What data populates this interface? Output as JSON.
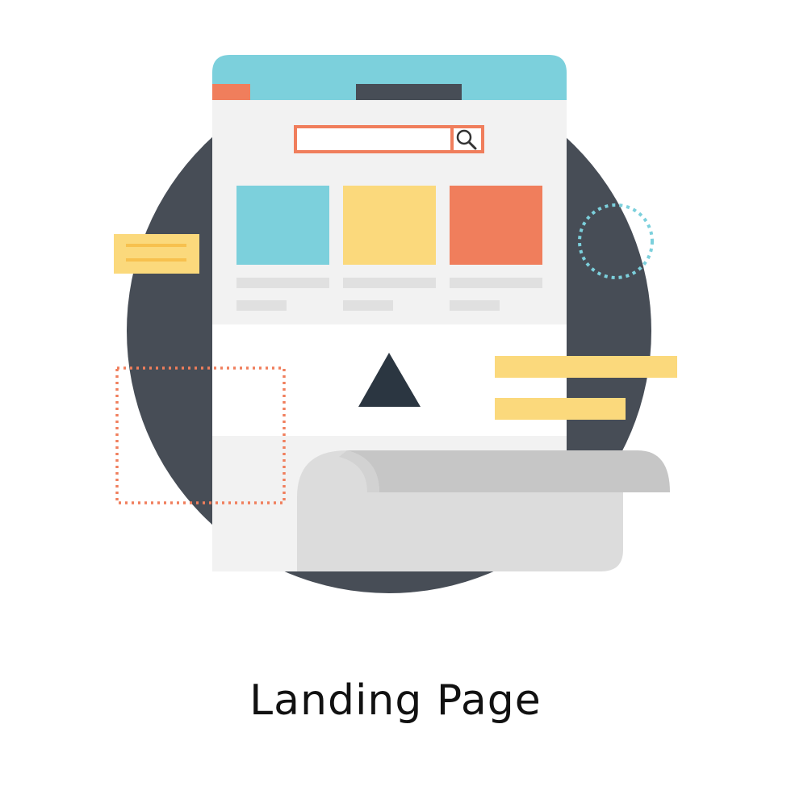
{
  "caption": "Landing Page",
  "icon": "search-icon",
  "colors": {
    "circle": "#474d56",
    "frame": "#f2f2f2",
    "topbar": "#7cd0dc",
    "accent_orange": "#f07e5c",
    "dark_tab": "#474d56",
    "card_blue": "#7cd0dc",
    "card_yellow": "#fbd97c",
    "card_orange": "#f07e5c",
    "placeholder_line": "#e0e0e0",
    "triangle": "#2b3641",
    "scroll_light": "#dcdcdc",
    "scroll_dark": "#c6c6c6",
    "dotted_blue": "#7cd0dc"
  }
}
